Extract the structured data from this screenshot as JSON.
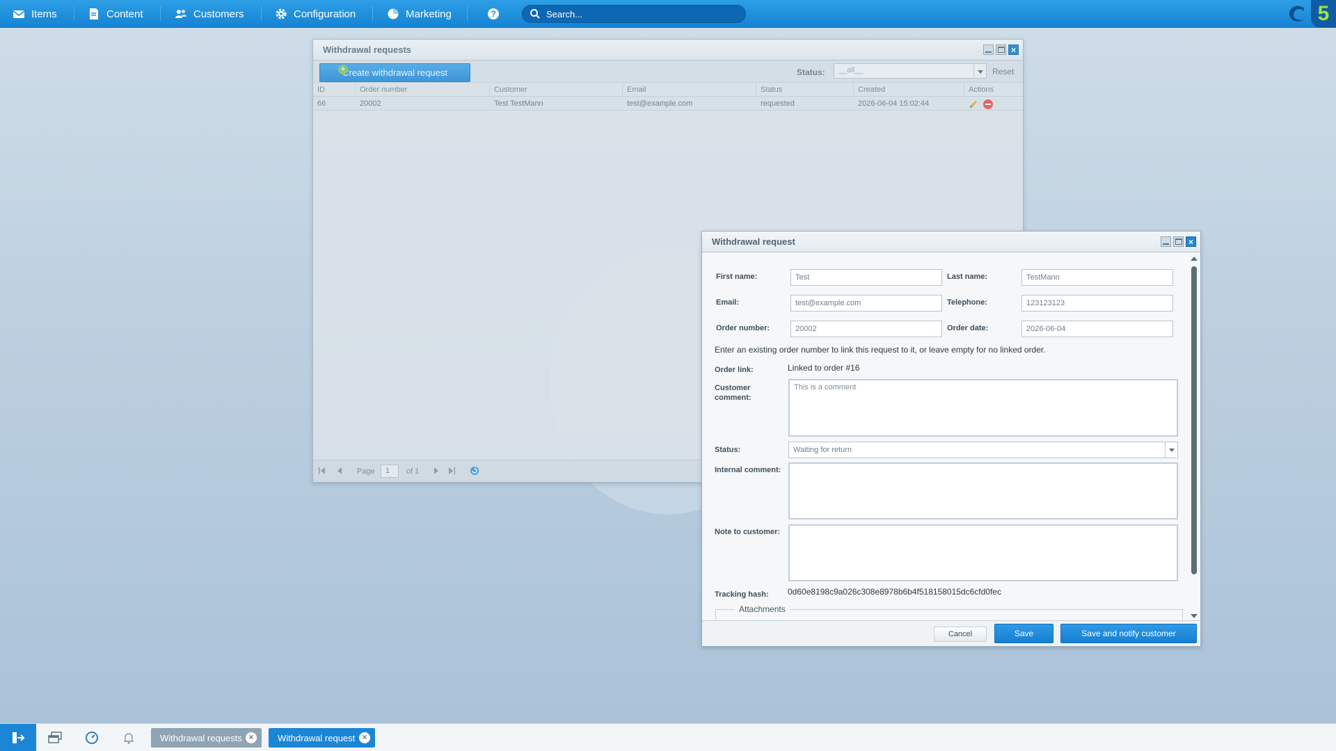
{
  "topbar": {
    "items": [
      {
        "label": "Items",
        "icon": "mail-icon"
      },
      {
        "label": "Content",
        "icon": "document-icon"
      },
      {
        "label": "Customers",
        "icon": "users-icon"
      },
      {
        "label": "Configuration",
        "icon": "gear-icon"
      },
      {
        "label": "Marketing",
        "icon": "pie-chart-icon"
      }
    ],
    "help_icon": "help-icon",
    "search_placeholder": "Search...",
    "logo_text": "5"
  },
  "list_window": {
    "title": "Withdrawal requests",
    "create_button": "Create withdrawal request",
    "status_label": "Status:",
    "status_value": "__all__",
    "reset_label": "Reset",
    "columns": [
      "ID",
      "Order number",
      "Customer",
      "Email",
      "Status",
      "Created",
      "Actions"
    ],
    "rows": [
      {
        "id": "66",
        "order_number": "20002",
        "customer": "Test TestMann",
        "email": "test@example.com",
        "status": "requested",
        "created": "2026-06-04 15:02:44"
      }
    ],
    "pager": {
      "page_label": "Page",
      "page_value": "1",
      "of_label": "of 1"
    }
  },
  "detail_window": {
    "title": "Withdrawal request",
    "first_name_label": "First name:",
    "first_name": "Test",
    "last_name_label": "Last name:",
    "last_name": "TestMann",
    "email_label": "Email:",
    "email": "test@example.com",
    "telephone_label": "Telephone:",
    "telephone": "123123123",
    "order_number_label": "Order number:",
    "order_number": "20002",
    "order_date_label": "Order date:",
    "order_date": "2026-06-04",
    "order_hint": "Enter an existing order number to link this request to it, or leave empty for no linked order.",
    "order_link_label": "Order link:",
    "order_link": "Linked to order #16",
    "customer_comment_label": "Customer comment:",
    "customer_comment": "This is a comment",
    "status_label": "Status:",
    "status": "Waiting for return",
    "internal_comment_label": "Internal comment:",
    "internal_comment": "",
    "note_label": "Note to customer:",
    "note": "",
    "tracking_hash_label": "Tracking hash:",
    "tracking_hash": "0d60e8198c9a026c308e8978b6b4f518158015dc6cfd0fec",
    "attachments_label": "Attachments",
    "cancel_button": "Cancel",
    "save_button": "Save",
    "save_notify_button": "Save and notify customer"
  },
  "taskbar": {
    "tabs": [
      {
        "label": "Withdrawal requests",
        "active": false
      },
      {
        "label": "Withdrawal request",
        "active": true
      }
    ]
  },
  "colors": {
    "accent": "#1583d3",
    "brand_green": "#a4e33e",
    "inactive_tab": "#8ea4b4"
  }
}
